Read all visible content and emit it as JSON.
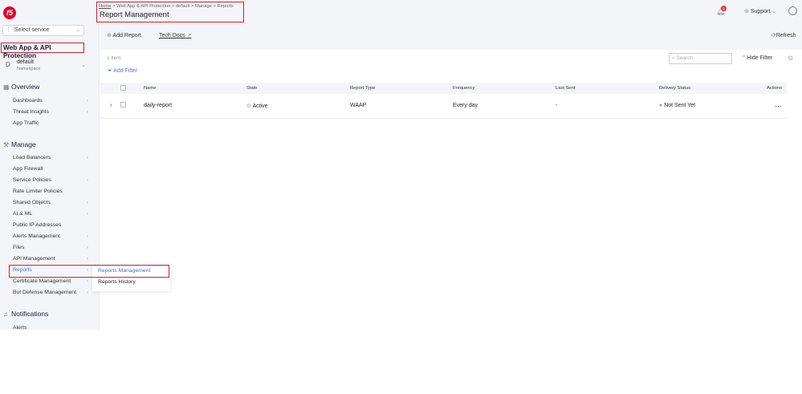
{
  "header": {
    "breadcrumb": [
      "Home",
      "Web App & API Protection",
      "default",
      "Manage",
      "Reports"
    ],
    "title": "Report Management",
    "notification_count": "5",
    "support": "Support"
  },
  "sidebar": {
    "select_service": "Select service",
    "workspace": "Web App & API Protection",
    "namespace": {
      "initial": "D",
      "name": "default",
      "label": "Namespace"
    },
    "overview": {
      "label": "Overview",
      "items": [
        {
          "label": "Dashboards",
          "sub": true
        },
        {
          "label": "Threat Insights",
          "sub": true
        },
        {
          "label": "App Traffic",
          "sub": false
        }
      ]
    },
    "manage": {
      "label": "Manage",
      "items": [
        {
          "label": "Load Balancers",
          "sub": true
        },
        {
          "label": "App Firewall",
          "sub": false
        },
        {
          "label": "Service Policies",
          "sub": true
        },
        {
          "label": "Rate Limiter Policies",
          "sub": false
        },
        {
          "label": "Shared Objects",
          "sub": true
        },
        {
          "label": "AI & ML",
          "sub": true
        },
        {
          "label": "Public IP Addresses",
          "sub": false
        },
        {
          "label": "Alerts Management",
          "sub": true
        },
        {
          "label": "Files",
          "sub": true
        },
        {
          "label": "API Management",
          "sub": true
        },
        {
          "label": "Reports",
          "sub": true
        },
        {
          "label": "Certificate Management",
          "sub": true
        },
        {
          "label": "Bot Defense Management",
          "sub": true
        }
      ]
    },
    "notifications": {
      "label": "Notifications",
      "items": [
        {
          "label": "Alerts"
        }
      ]
    },
    "submenu": [
      "Reports Management",
      "Reports History"
    ]
  },
  "toolbar": {
    "add": "Add Report",
    "docs": "Tech Docs",
    "refresh": "Refresh",
    "count": "1 Item",
    "add_filter": "Add Filter",
    "search_placeholder": "Search",
    "hide_filter": "Hide Filter"
  },
  "table": {
    "columns": [
      "Name",
      "State",
      "Report Type",
      "Frequency",
      "Last Sent",
      "Delivery Status",
      "Actions"
    ],
    "rows": [
      {
        "name": "daily-report",
        "state": "Active",
        "type": "WAAP",
        "frequency": "Every day",
        "last_sent": "-",
        "delivery": "Not Sent Yet"
      }
    ]
  }
}
